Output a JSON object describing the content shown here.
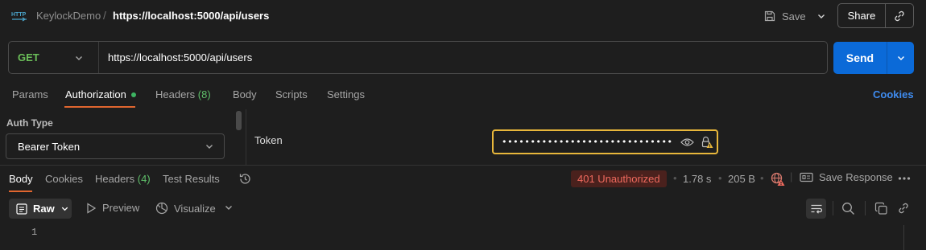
{
  "header": {
    "collection": "KeylockDemo",
    "separator": "/",
    "request_name": "https://localhost:5000/api/users",
    "save_label": "Save",
    "share_label": "Share"
  },
  "request": {
    "method": "GET",
    "url": "https://localhost:5000/api/users",
    "send_label": "Send",
    "method_color": "#6bbf59",
    "send_color": "#0b6ad8"
  },
  "request_tabs": {
    "params": "Params",
    "authorization": "Authorization",
    "headers": "Headers",
    "headers_count": "(8)",
    "body": "Body",
    "scripts": "Scripts",
    "settings": "Settings",
    "cookies": "Cookies"
  },
  "auth": {
    "type_label": "Auth Type",
    "type_value": "Bearer Token",
    "token_label": "Token",
    "token_value": "••••••••••••••••••••••••••••••••••",
    "token_border_color": "#e8b73b"
  },
  "response_tabs": {
    "body": "Body",
    "cookies": "Cookies",
    "headers": "Headers",
    "headers_count": "(4)",
    "test_results": "Test Results"
  },
  "response_meta": {
    "status": "401 Unauthorized",
    "time": "1.78 s",
    "size": "205 B",
    "save_response": "Save Response",
    "status_color": "#ef6a5e"
  },
  "body_toolbar": {
    "raw": "Raw",
    "preview": "Preview",
    "visualize": "Visualize"
  },
  "editor": {
    "line_numbers": [
      "1"
    ]
  },
  "icons": {
    "http": "http-icon",
    "save": "save-icon",
    "link": "link-icon",
    "history": "history-icon",
    "globe_warning": "globe-warning-icon",
    "eye": "eye-icon",
    "lock_warning": "lock-warning-icon"
  }
}
